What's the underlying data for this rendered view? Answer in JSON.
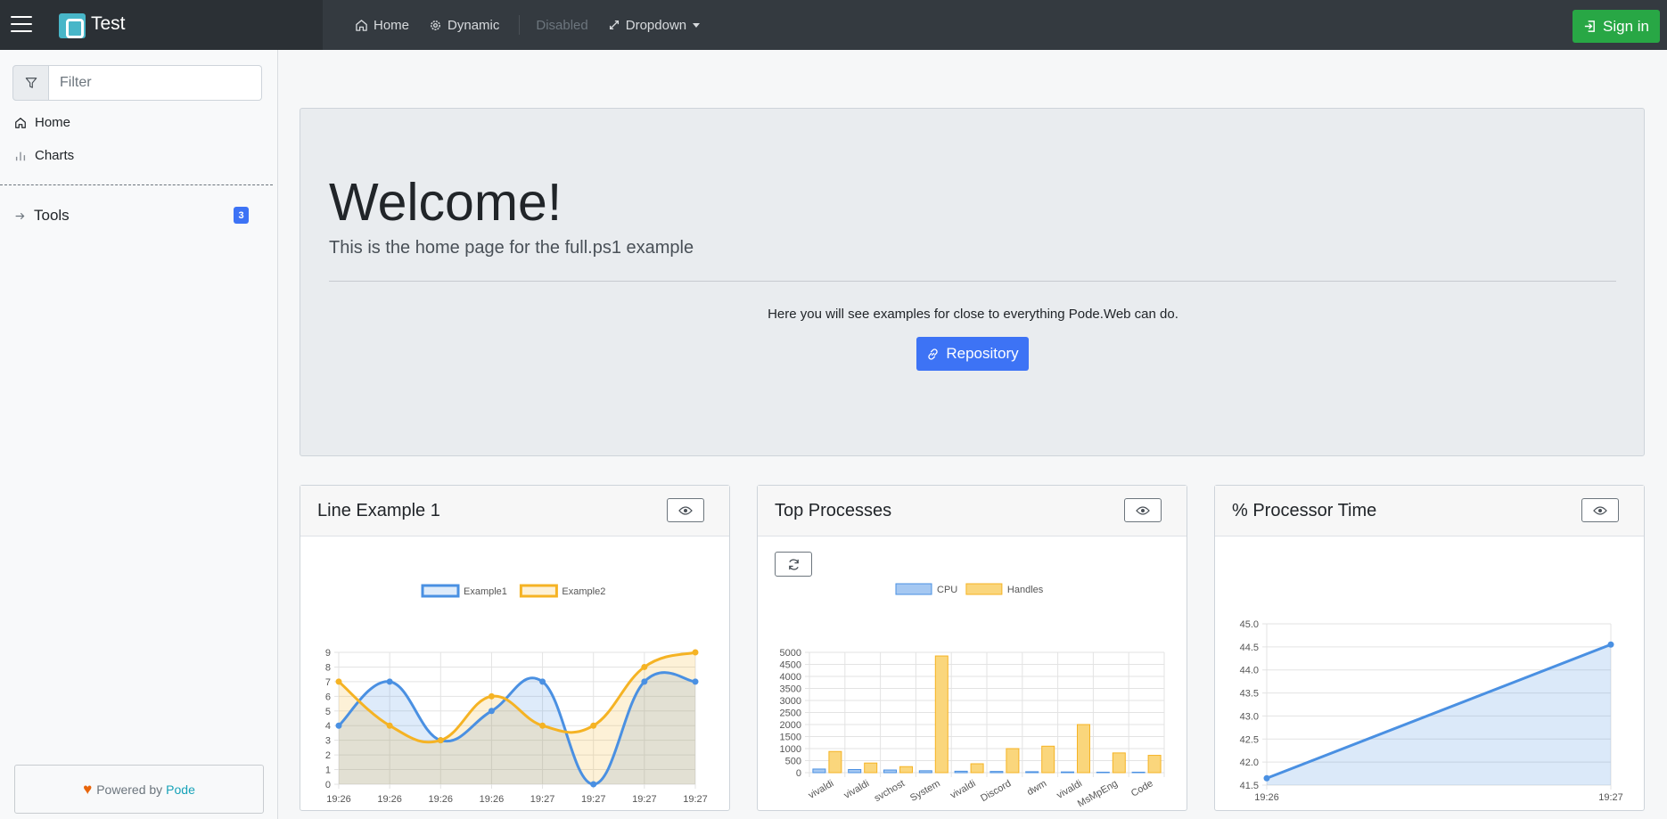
{
  "navbar": {
    "brand": "Test",
    "items": [
      {
        "label": "Home",
        "icon": "home-icon"
      },
      {
        "label": "Dynamic",
        "icon": "gear-icon"
      },
      {
        "label": "Disabled"
      },
      {
        "label": "Dropdown",
        "icon": "expand-icon"
      }
    ],
    "signin_label": "Sign in"
  },
  "sidebar": {
    "filter_placeholder": "Filter",
    "links": [
      {
        "label": "Home",
        "icon": "home-icon"
      },
      {
        "label": "Charts",
        "icon": "bar-chart-icon"
      }
    ],
    "tools": {
      "label": "Tools",
      "badge": "3"
    },
    "powered_by": {
      "prefix": "Powered by",
      "link": "Pode"
    }
  },
  "jumbotron": {
    "title": "Welcome!",
    "lead": "This is the home page for the full.ps1 example",
    "description": "Here you will see examples for close to everything Pode.Web can do.",
    "button": "Repository"
  },
  "cards": [
    {
      "title": "Line Example 1"
    },
    {
      "title": "Top Processes"
    },
    {
      "title": "% Processor Time"
    }
  ],
  "colors": {
    "blue": "#4a90e2",
    "orange": "#f5b324",
    "handles": "#fad67c",
    "cpu": "#a5c8f2"
  },
  "chart_data": [
    {
      "type": "line",
      "x": [
        "19:26",
        "19:26",
        "19:26",
        "19:26",
        "19:27",
        "19:27",
        "19:27",
        "19:27"
      ],
      "series": [
        {
          "name": "Example1",
          "values": [
            4,
            7,
            3,
            5,
            7,
            0,
            7,
            7
          ]
        },
        {
          "name": "Example2",
          "values": [
            7,
            4,
            3,
            6,
            4,
            4,
            8,
            9
          ]
        }
      ],
      "ylim": [
        0,
        9
      ],
      "yticks": [
        0,
        1,
        2,
        3,
        4,
        5,
        6,
        7,
        8,
        9
      ],
      "legend": "top"
    },
    {
      "type": "bar",
      "categories": [
        "vivaldi",
        "vivaldi",
        "svchost",
        "System",
        "vivaldi",
        "Discord",
        "dwm",
        "vivaldi",
        "MsMpEng",
        "Code"
      ],
      "series": [
        {
          "name": "CPU",
          "values": [
            150,
            130,
            110,
            80,
            60,
            50,
            40,
            30,
            20,
            20
          ]
        },
        {
          "name": "Handles",
          "values": [
            880,
            400,
            250,
            4850,
            370,
            1000,
            1100,
            2000,
            820,
            720
          ]
        }
      ],
      "ylim": [
        0,
        5000
      ],
      "yticks": [
        0,
        500,
        1000,
        1500,
        2000,
        2500,
        3000,
        3500,
        4000,
        4500,
        5000
      ],
      "legend": "top"
    },
    {
      "type": "area",
      "x": [
        "19:26",
        "19:27"
      ],
      "values": [
        41.65,
        44.55
      ],
      "ylim": [
        41.5,
        45.0
      ],
      "yticks": [
        "41.5",
        "42.0",
        "42.5",
        "43.0",
        "43.5",
        "44.0",
        "44.5",
        "45.0"
      ]
    }
  ]
}
